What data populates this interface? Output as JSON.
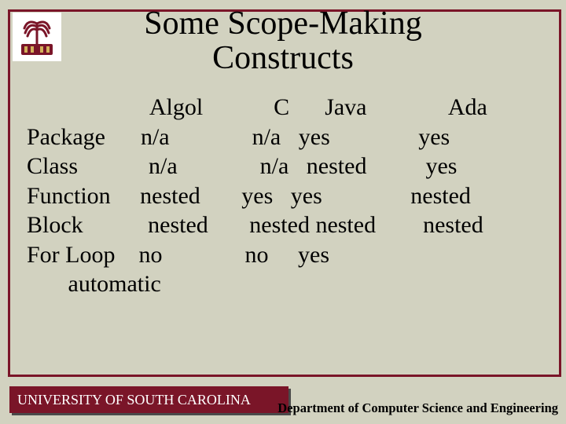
{
  "title": "Some Scope-Making\nConstructs",
  "content_block": "                     Algol            C      Java              Ada\nPackage      n/a              n/a   yes               yes\nClass            n/a              n/a   nested          yes\nFunction     nested       yes   yes               nested\nBlock           nested       nested nested        nested\nFor Loop    no              no     yes\n       automatic",
  "footer_left": "UNIVERSITY OF SOUTH CAROLINA",
  "footer_right": "Department of Computer Science and Engineering",
  "chart_data": {
    "type": "table",
    "title": "Some Scope-Making Constructs",
    "columns": [
      "",
      "Algol",
      "C",
      "Java",
      "Ada"
    ],
    "rows": [
      {
        "label": "Package",
        "Algol": "n/a",
        "C": "n/a",
        "Java": "yes",
        "Ada": "yes"
      },
      {
        "label": "Class",
        "Algol": "n/a",
        "C": "n/a",
        "Java": "nested",
        "Ada": "yes"
      },
      {
        "label": "Function",
        "Algol": "nested",
        "C": "yes",
        "Java": "yes",
        "Ada": "nested"
      },
      {
        "label": "Block",
        "Algol": "nested",
        "C": "nested",
        "Java": "nested",
        "Ada": "nested"
      },
      {
        "label": "For Loop",
        "Algol": "no",
        "C": "no",
        "Java": "yes",
        "Ada": "automatic"
      }
    ]
  }
}
